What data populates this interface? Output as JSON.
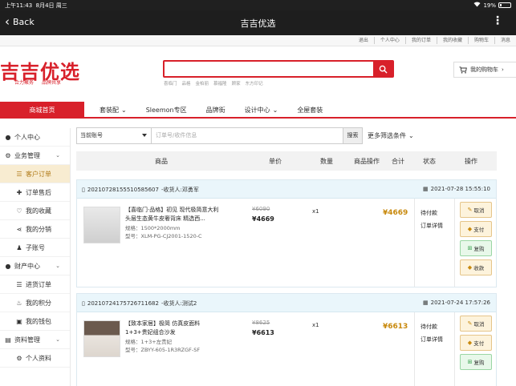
{
  "status_bar": {
    "time": "上午11:43",
    "date": "8月4日 周三",
    "battery": "19%"
  },
  "nav": {
    "back_label": "Back",
    "title": "吉吉优选"
  },
  "top_links": [
    "退出",
    "个人中心",
    "我的订单",
    "我的收藏",
    "购物车",
    "消息"
  ],
  "header": {
    "logo": "吉吉优选",
    "slogan": [
      "合力聚务",
      "品牌共享"
    ],
    "search_placeholder": "",
    "hot_words": [
      "喜临门",
      "品格",
      "金柏丽",
      "慕福隆",
      "顾家",
      "东方印记"
    ],
    "cart_label": "我的购物车",
    "cart_arrow": "›"
  },
  "main_nav": {
    "home": "商城首页",
    "items": [
      {
        "label": "套装配",
        "caret": "⌄"
      },
      {
        "label": "Sleemon专区",
        "caret": ""
      },
      {
        "label": "品牌街",
        "caret": ""
      },
      {
        "label": "设计中心",
        "caret": "⌄"
      },
      {
        "label": "全屋套装",
        "caret": ""
      }
    ]
  },
  "sidebar": {
    "items": [
      {
        "label": "个人中心",
        "icon": "person-icon",
        "type": "group"
      },
      {
        "label": "业务管理",
        "icon": "gear-icon",
        "type": "group",
        "caret": "⌄"
      },
      {
        "label": "客户订单",
        "icon": "list-icon",
        "type": "sub",
        "active": true
      },
      {
        "label": "订单售后",
        "icon": "puzzle-icon",
        "type": "sub"
      },
      {
        "label": "我的收藏",
        "icon": "heart-icon",
        "type": "sub"
      },
      {
        "label": "我的分销",
        "icon": "share-icon",
        "type": "sub"
      },
      {
        "label": "子账号",
        "icon": "user-icon",
        "type": "sub"
      },
      {
        "label": "财产中心",
        "icon": "person-icon",
        "type": "group",
        "caret": "⌄"
      },
      {
        "label": "进货订单",
        "icon": "list-icon",
        "type": "sub"
      },
      {
        "label": "我的积分",
        "icon": "flame-icon",
        "type": "sub"
      },
      {
        "label": "我的钱包",
        "icon": "wallet-icon",
        "type": "sub"
      },
      {
        "label": "资料管理",
        "icon": "doc-icon",
        "type": "group",
        "caret": "⌄"
      },
      {
        "label": "个人资料",
        "icon": "gear-icon",
        "type": "sub"
      }
    ]
  },
  "filter": {
    "account_select": "当前账号",
    "order_placeholder": "订单号/收件信息",
    "search_button": "搜索",
    "more_filter": "更多筛选条件"
  },
  "table_headers": {
    "product": "商品",
    "unit_price": "单价",
    "quantity": "数量",
    "product_action": "商品操作",
    "total": "合计",
    "status": "状态",
    "action": "操作"
  },
  "orders": [
    {
      "order_no": "20210728155510585607",
      "recipient": "-收货人:邓勇军",
      "time": "2021-07-28 15:55:10",
      "product_name": "【喜临门·品格】初见 现代极简意大利头层生态黄牛皮奢背床 精选西...",
      "spec1": "规格：1500*2000mm",
      "spec2": "型号：XLM-PG-CJ2001-1520-C",
      "old_price": "¥6090",
      "price": "¥4669",
      "qty": "x1",
      "total": "¥4669",
      "status": "待付款",
      "detail": "订单详情",
      "buttons": [
        "取消",
        "支付",
        "复购",
        "收款"
      ]
    },
    {
      "order_no": "20210724175726711682",
      "recipient": "-收货人:测试2",
      "time": "2021-07-24 17:57:26",
      "product_name": "【致本家居】极简 仿真皮面料1+3+贵妃组合沙发",
      "spec1": "规格：1+3+左贵妃",
      "spec2": "型号：ZBYY-605-1R3RZGF-SF",
      "old_price": "¥8625",
      "price": "¥6613",
      "qty": "x1",
      "total": "¥6613",
      "status": "待付款",
      "detail": "订单详情",
      "buttons": [
        "取消",
        "支付",
        "复购"
      ]
    }
  ],
  "colors": {
    "brand_red": "#d8202a",
    "gold": "#c8890d",
    "active_bg": "#f8ecd1"
  }
}
